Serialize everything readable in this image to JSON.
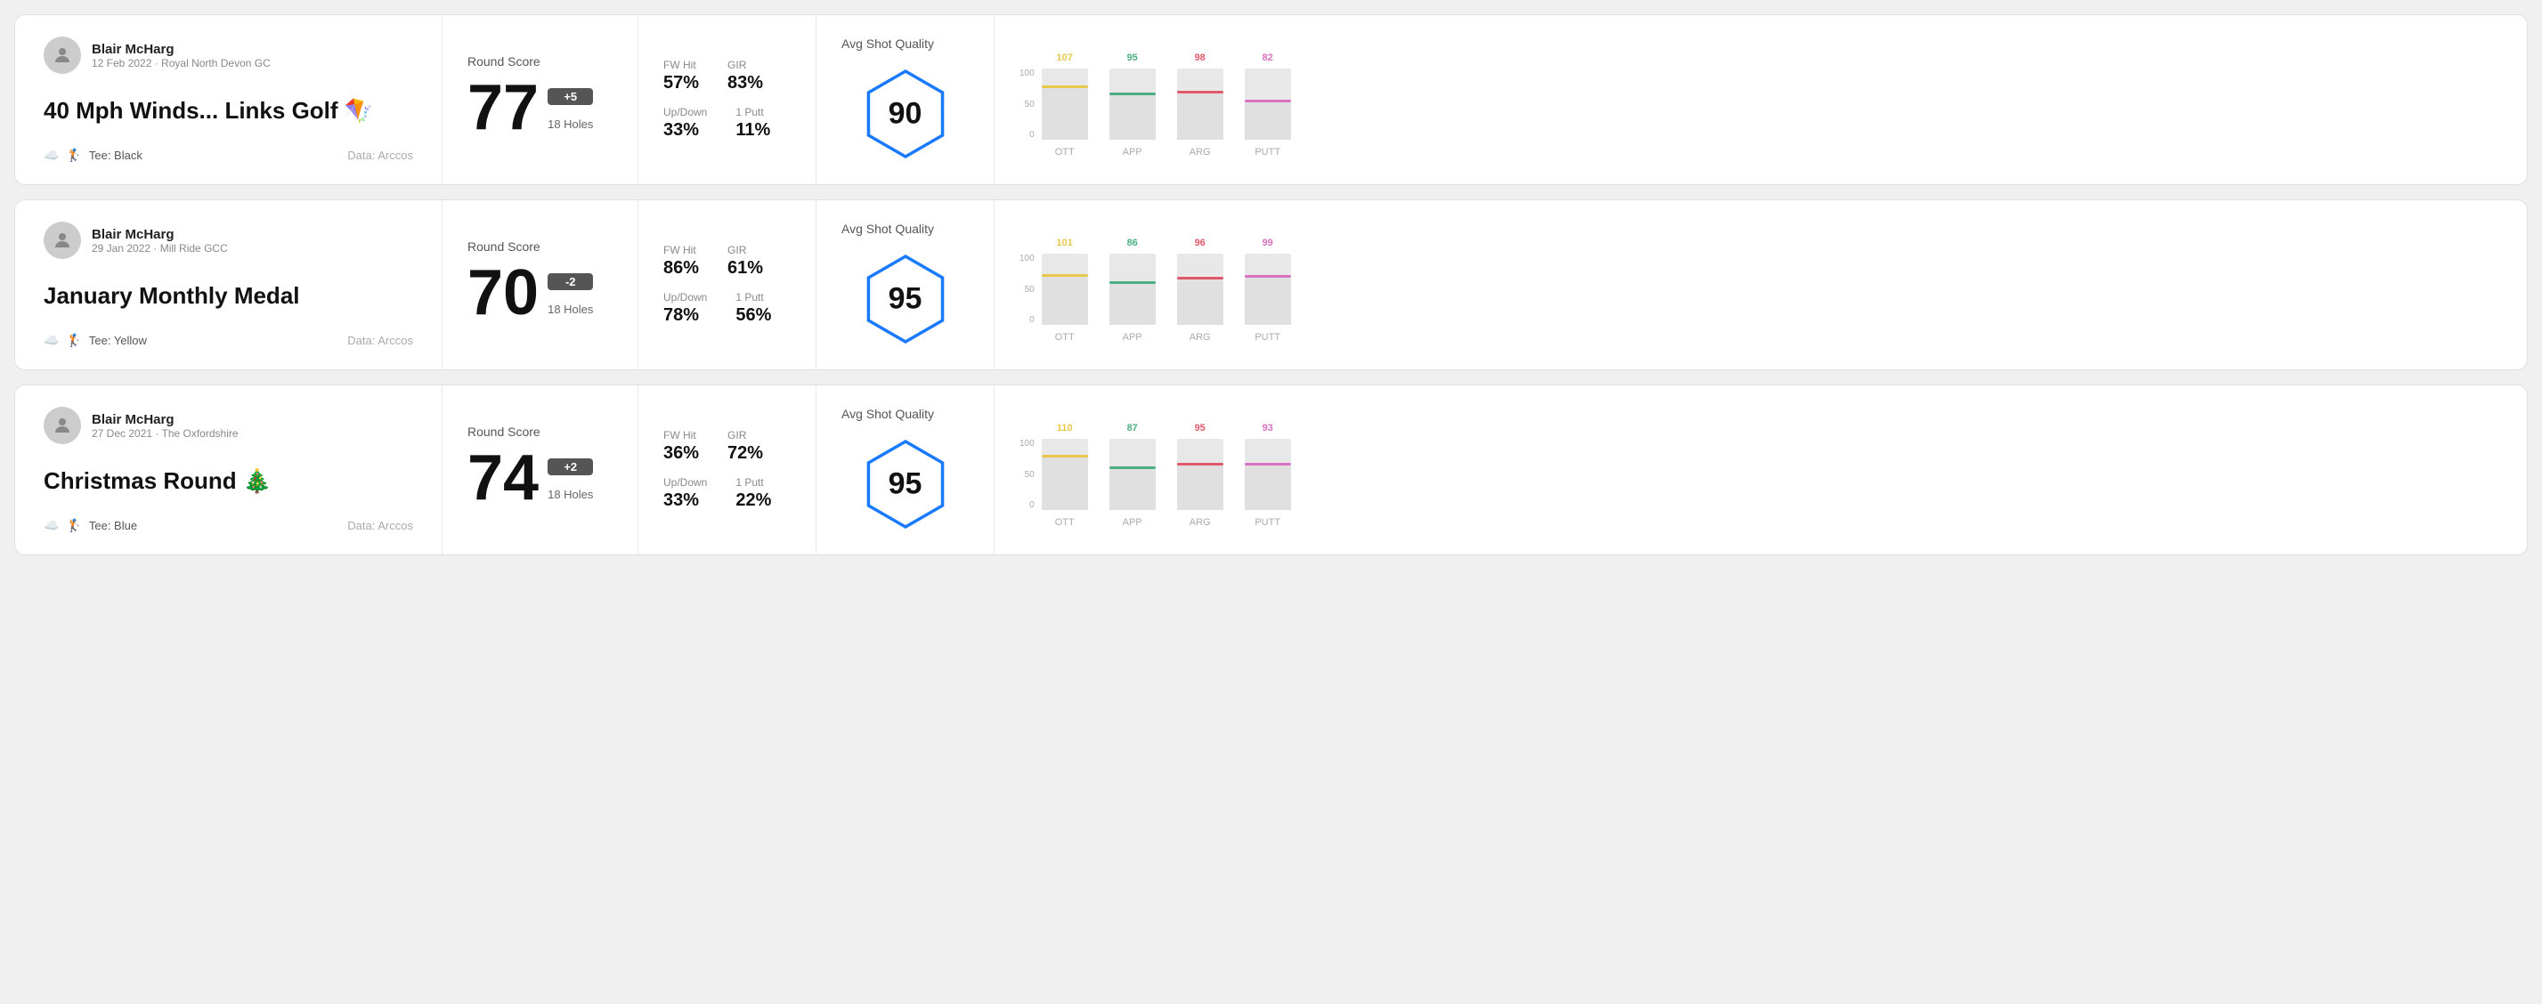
{
  "rounds": [
    {
      "id": "round1",
      "user": {
        "name": "Blair McHarg",
        "meta": "12 Feb 2022 · Royal North Devon GC"
      },
      "title": "40 Mph Winds... Links Golf 🪁",
      "tee": "Black",
      "data_source": "Data: Arccos",
      "score": {
        "label": "Round Score",
        "number": "77",
        "badge": "+5",
        "holes": "18 Holes"
      },
      "stats": {
        "fw_hit_label": "FW Hit",
        "fw_hit_value": "57%",
        "gir_label": "GIR",
        "gir_value": "83%",
        "updown_label": "Up/Down",
        "updown_value": "33%",
        "oneputt_label": "1 Putt",
        "oneputt_value": "11%"
      },
      "quality": {
        "label": "Avg Shot Quality",
        "score": "90"
      },
      "chart": {
        "y_labels": [
          "100",
          "50",
          "0"
        ],
        "columns": [
          {
            "label": "OTT",
            "value": 107,
            "color": "#e8c84a",
            "bar_pct": 72
          },
          {
            "label": "APP",
            "value": 95,
            "color": "#4caf82",
            "bar_pct": 62
          },
          {
            "label": "ARG",
            "value": 98,
            "color": "#e05a6a",
            "bar_pct": 65
          },
          {
            "label": "PUTT",
            "value": 82,
            "color": "#d972c0",
            "bar_pct": 52
          }
        ]
      }
    },
    {
      "id": "round2",
      "user": {
        "name": "Blair McHarg",
        "meta": "29 Jan 2022 · Mill Ride GCC"
      },
      "title": "January Monthly Medal",
      "tee": "Yellow",
      "data_source": "Data: Arccos",
      "score": {
        "label": "Round Score",
        "number": "70",
        "badge": "-2",
        "holes": "18 Holes"
      },
      "stats": {
        "fw_hit_label": "FW Hit",
        "fw_hit_value": "86%",
        "gir_label": "GIR",
        "gir_value": "61%",
        "updown_label": "Up/Down",
        "updown_value": "78%",
        "oneputt_label": "1 Putt",
        "oneputt_value": "56%"
      },
      "quality": {
        "label": "Avg Shot Quality",
        "score": "95"
      },
      "chart": {
        "y_labels": [
          "100",
          "50",
          "0"
        ],
        "columns": [
          {
            "label": "OTT",
            "value": 101,
            "color": "#e8c84a",
            "bar_pct": 68
          },
          {
            "label": "APP",
            "value": 86,
            "color": "#4caf82",
            "bar_pct": 58
          },
          {
            "label": "ARG",
            "value": 96,
            "color": "#e05a6a",
            "bar_pct": 64
          },
          {
            "label": "PUTT",
            "value": 99,
            "color": "#d972c0",
            "bar_pct": 66
          }
        ]
      }
    },
    {
      "id": "round3",
      "user": {
        "name": "Blair McHarg",
        "meta": "27 Dec 2021 · The Oxfordshire"
      },
      "title": "Christmas Round 🎄",
      "tee": "Blue",
      "data_source": "Data: Arccos",
      "score": {
        "label": "Round Score",
        "number": "74",
        "badge": "+2",
        "holes": "18 Holes"
      },
      "stats": {
        "fw_hit_label": "FW Hit",
        "fw_hit_value": "36%",
        "gir_label": "GIR",
        "gir_value": "72%",
        "updown_label": "Up/Down",
        "updown_value": "33%",
        "oneputt_label": "1 Putt",
        "oneputt_value": "22%"
      },
      "quality": {
        "label": "Avg Shot Quality",
        "score": "95"
      },
      "chart": {
        "y_labels": [
          "100",
          "50",
          "0"
        ],
        "columns": [
          {
            "label": "OTT",
            "value": 110,
            "color": "#e8c84a",
            "bar_pct": 74
          },
          {
            "label": "APP",
            "value": 87,
            "color": "#4caf82",
            "bar_pct": 58
          },
          {
            "label": "ARG",
            "value": 95,
            "color": "#e05a6a",
            "bar_pct": 63
          },
          {
            "label": "PUTT",
            "value": 93,
            "color": "#d972c0",
            "bar_pct": 62
          }
        ]
      }
    }
  ]
}
